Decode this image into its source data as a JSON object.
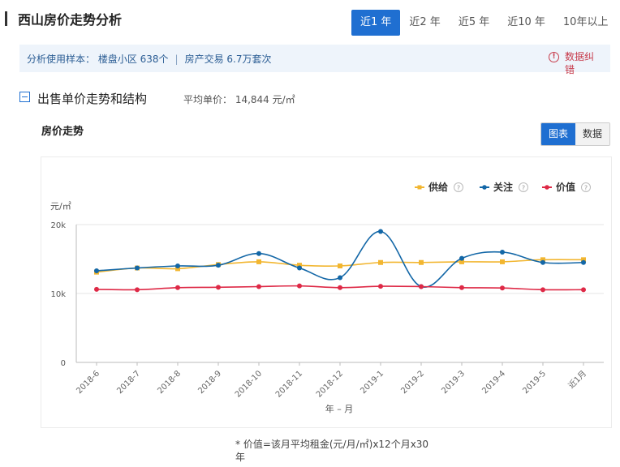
{
  "header": {
    "title": "西山房价走势分析"
  },
  "tabs": [
    {
      "label": "近1 年",
      "active": true
    },
    {
      "label": "近2 年",
      "active": false
    },
    {
      "label": "近5 年",
      "active": false
    },
    {
      "label": "近10 年",
      "active": false
    },
    {
      "label": "10年以上",
      "active": false
    }
  ],
  "info": {
    "sample": "分析使用样本： 楼盘小区 638个",
    "separator": "|",
    "trade": "房产交易 6.7万套次",
    "error_icon": "!",
    "error_label": "数据纠错"
  },
  "section": {
    "title": "出售单价走势和结构",
    "avg_price": "平均单价： 14,844 元/㎡"
  },
  "chart_panel": {
    "title": "房价走势",
    "view_chart": "图表",
    "view_data": "数据"
  },
  "chart_data": {
    "type": "line",
    "unit": "元/㎡",
    "xlabel": "年 – 月",
    "categories": [
      "2018-6",
      "2018-7",
      "2018-8",
      "2018-9",
      "2018-10",
      "2018-11",
      "2018-12",
      "2019-1",
      "2019-2",
      "2019-3",
      "2019-4",
      "2019-5",
      "近1月"
    ],
    "ylim": [
      0,
      20000
    ],
    "yticks": [
      {
        "value": 0,
        "label": "0"
      },
      {
        "value": 10000,
        "label": "10k"
      },
      {
        "value": 20000,
        "label": "20k"
      }
    ],
    "grid": true,
    "legend_position": "top-right",
    "help_icon": "?",
    "series": [
      {
        "name": "供给",
        "color": "#f2b630",
        "values": [
          13100,
          13700,
          13600,
          14200,
          14600,
          14100,
          14000,
          14500,
          14500,
          14600,
          14600,
          14900,
          14900
        ]
      },
      {
        "name": "关注",
        "color": "#1367a7",
        "values": [
          13300,
          13700,
          14000,
          14100,
          15800,
          13700,
          12300,
          19000,
          11000,
          15100,
          16000,
          14500,
          14500
        ]
      },
      {
        "name": "价值",
        "color": "#de2946",
        "values": [
          10600,
          10550,
          10850,
          10900,
          11000,
          11100,
          10850,
          11050,
          11000,
          10850,
          10800,
          10550,
          10550
        ]
      }
    ]
  },
  "footnote": "* 价值=该月平均租金(元/月/㎡)x12个月x30年"
}
